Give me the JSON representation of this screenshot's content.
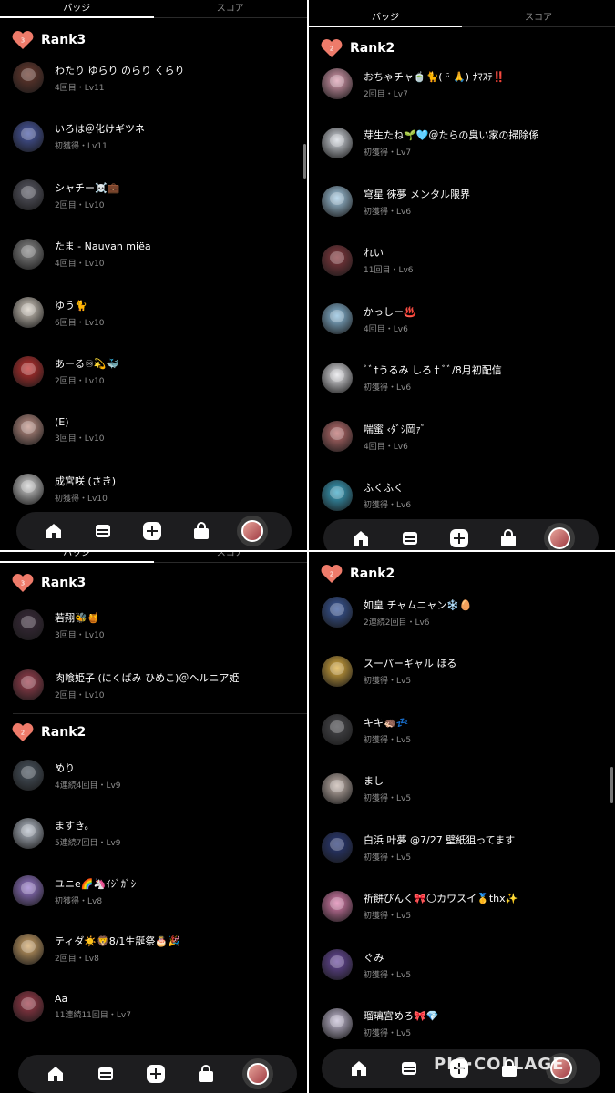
{
  "tabs": {
    "badge": "バッジ",
    "score": "スコア"
  },
  "panels": [
    {
      "rank": "Rank3",
      "items": [
        {
          "name": "わたり ゆらり のらり くらり",
          "meta": "4回目・Lv11",
          "color": "#6b3a2e"
        },
        {
          "name": "いろは＠化けギツネ",
          "meta": "初獲得・Lv11",
          "color": "#4a5aa8"
        },
        {
          "name": "シャチー☠️💼",
          "meta": "2回目・Lv10",
          "color": "#5a5a66"
        },
        {
          "name": "たま - Nauvan miëa",
          "meta": "4回目・Lv10",
          "color": "#8a8a8a"
        },
        {
          "name": "ゆう🐈",
          "meta": "6回目・Lv10",
          "color": "#d8d0c4"
        },
        {
          "name": "あーる♾💫🐳",
          "meta": "2回目・Lv10",
          "color": "#c4302e"
        },
        {
          "name": "(E)",
          "meta": "3回目・Lv10",
          "color": "#c4958a"
        },
        {
          "name": "成宮咲 (さき)",
          "meta": "初獲得・Lv10",
          "color": "#d4d4d4"
        }
      ]
    },
    {
      "rank": "Rank2",
      "items": [
        {
          "name": "おちゃチャ🍵🐈( ᵕ̈ 🙏) ﾅﾏｽﾃ‼️",
          "meta": "2回目・Lv7",
          "color": "#e0a0b4"
        },
        {
          "name": "芽生たね🌱🩵＠たらの臭い家の掃除係",
          "meta": "初獲得・Lv7",
          "color": "#d8dde4"
        },
        {
          "name": "穹星 徠夢 メンタル限界",
          "meta": "初獲得・Lv6",
          "color": "#a8cfe8"
        },
        {
          "name": "れい",
          "meta": "11回目・Lv6",
          "color": "#8a3a40"
        },
        {
          "name": "かっしー♨️",
          "meta": "4回目・Lv6",
          "color": "#8ec0e0"
        },
        {
          "name": "ﾞﾞ†うるみ しろ†ﾞﾞ/8月初配信",
          "meta": "初獲得・Lv6",
          "color": "#e8e8ec"
        },
        {
          "name": "喘蜜 ‹ﾀﾞｼ岡ｧﾞ",
          "meta": "4回目・Lv6",
          "color": "#c07070"
        },
        {
          "name": "ふくふく",
          "meta": "初獲得・Lv6",
          "color": "#3aa8c8"
        }
      ]
    },
    {
      "rank3": "Rank3",
      "items3": [
        {
          "name": "若翔🐝🍯",
          "meta": "3回目・Lv10",
          "color": "#3a2a3a"
        },
        {
          "name": "肉喰姫子 (にくばみ ひめこ)＠ヘルニア姫",
          "meta": "2回目・Lv10",
          "color": "#a04050"
        }
      ],
      "rank2": "Rank2",
      "items2": [
        {
          "name": "めり",
          "meta": "4連続4回目・Lv9",
          "color": "#4a5560"
        },
        {
          "name": "ますき。",
          "meta": "5連続7回目・Lv9",
          "color": "#b8c0cc"
        },
        {
          "name": "ユニe🌈🦄ｲｼﾞｶﾞｼ",
          "meta": "初獲得・Lv8",
          "color": "#9a7ad0"
        },
        {
          "name": "ティダ☀️🦁8/1生誕祭🎂🎉",
          "meta": "2回目・Lv8",
          "color": "#d4a86a"
        },
        {
          "name": "Aa",
          "meta": "11連続11回目・Lv7",
          "color": "#a03a4a"
        }
      ]
    },
    {
      "rank": "Rank2",
      "items": [
        {
          "name": "如皇 チャムニャン❄️🥚",
          "meta": "2連続2回目・Lv6",
          "color": "#3a5aa0"
        },
        {
          "name": "スーパーギャル ほる",
          "meta": "初獲得・Lv5",
          "color": "#e0b040"
        },
        {
          "name": "キキ🦔💤",
          "meta": "初獲得・Lv5",
          "color": "#4a4a4e"
        },
        {
          "name": "まし",
          "meta": "初獲得・Lv5",
          "color": "#c8b8b0"
        },
        {
          "name": "白浜 叶夢 @7/27 壁紙狙ってます",
          "meta": "初獲得・Lv5",
          "color": "#2a3a7a"
        },
        {
          "name": "祈餅ぴんく🎀🌕カワスイ🥇thx✨",
          "meta": "初獲得・Lv5",
          "color": "#e080b0"
        },
        {
          "name": "ぐみ",
          "meta": "初獲得・Lv5",
          "color": "#6a4aa0"
        },
        {
          "name": "瑠璃宮めろ🎀💎",
          "meta": "初獲得・Lv5",
          "color": "#c8c0d8"
        }
      ]
    }
  ],
  "nav": [
    "home-icon",
    "inbox-icon",
    "add-icon",
    "shop-icon",
    "profile-avatar"
  ],
  "watermark": "PIC·COLLAGE",
  "colors": {
    "accent": "#ee7b6a",
    "background": "#000000",
    "subtext": "#8e8e8e"
  }
}
